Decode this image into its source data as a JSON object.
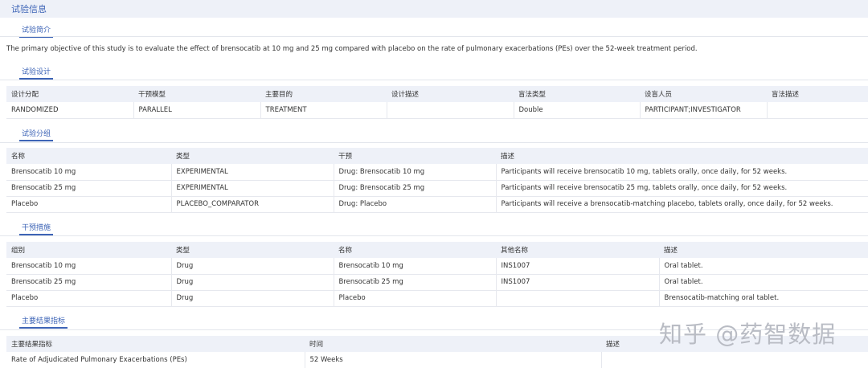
{
  "header": {
    "title": "试验信息"
  },
  "summary": {
    "tab": "试验简介",
    "text": "The primary objective of this study is to evaluate the effect of brensocatib at 10 mg and 25 mg compared with placebo on the rate of pulmonary exacerbations (PEs) over the 52-week treatment period."
  },
  "design": {
    "tab": "试验设计",
    "headers": [
      "设计分配",
      "干预模型",
      "主要目的",
      "设计描述",
      "盲法类型",
      "设盲人员",
      "盲法描述"
    ],
    "row": [
      "RANDOMIZED",
      "PARALLEL",
      "TREATMENT",
      "",
      "Double",
      "PARTICIPANT;INVESTIGATOR",
      ""
    ]
  },
  "arms": {
    "tab": "试验分组",
    "headers": [
      "名称",
      "类型",
      "干预",
      "描述"
    ],
    "rows": [
      [
        "Brensocatib 10 mg",
        "EXPERIMENTAL",
        "Drug: Brensocatib 10 mg",
        "Participants will receive brensocatib 10 mg, tablets orally, once daily, for 52 weeks."
      ],
      [
        "Brensocatib 25 mg",
        "EXPERIMENTAL",
        "Drug: Brensocatib 25 mg",
        "Participants will receive brensocatib 25 mg, tablets orally, once daily, for 52 weeks."
      ],
      [
        "Placebo",
        "PLACEBO_COMPARATOR",
        "Drug: Placebo",
        "Participants will receive a brensocatib-matching placebo, tablets orally, once daily, for 52 weeks."
      ]
    ]
  },
  "interventions": {
    "tab": "干预措施",
    "headers": [
      "组别",
      "类型",
      "名称",
      "其他名称",
      "描述"
    ],
    "rows": [
      [
        "Brensocatib 10 mg",
        "Drug",
        "Brensocatib 10 mg",
        "INS1007",
        "Oral tablet."
      ],
      [
        "Brensocatib 25 mg",
        "Drug",
        "Brensocatib 25 mg",
        "INS1007",
        "Oral tablet."
      ],
      [
        "Placebo",
        "Drug",
        "Placebo",
        "",
        "Brensocatib-matching oral tablet."
      ]
    ]
  },
  "outcomes": {
    "tab": "主要结果指标",
    "headers": [
      "主要结果指标",
      "时间",
      "描述"
    ],
    "rows": [
      [
        "Rate of Adjudicated Pulmonary Exacerbations (PEs)",
        "52 Weeks",
        ""
      ]
    ]
  },
  "watermark": "知乎 @药智数据",
  "colors": {
    "accent": "#3d64b6",
    "header_bg": "#eef1f8",
    "border": "#e6e8ee"
  }
}
